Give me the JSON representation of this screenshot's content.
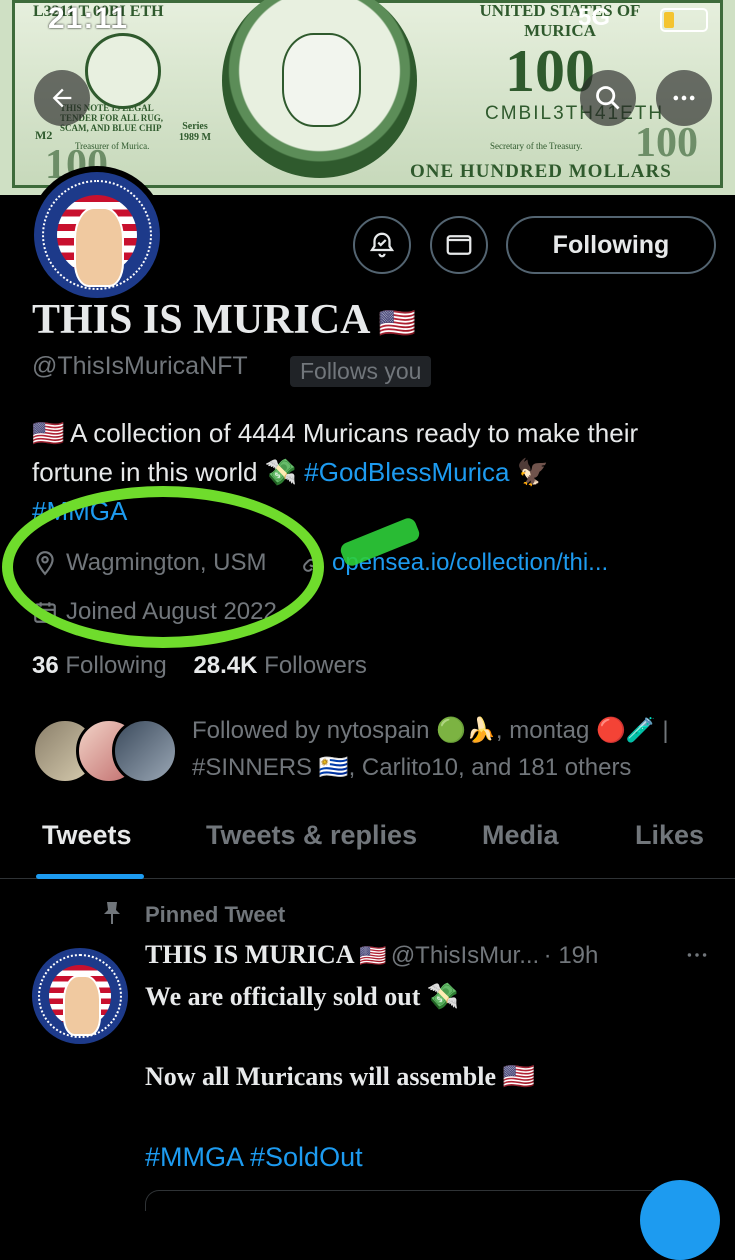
{
  "status_bar": {
    "time": "21:11",
    "network": "5G"
  },
  "banner": {
    "top_left_text": "L3211 T 00BI ETH",
    "top_right_text": "UNITED STATES OF MURICA",
    "big_number": "100",
    "serial": "CMBIL3TH41ETH",
    "bottom_text": "ONE HUNDRED MOLLARS",
    "tender_text": "THIS NOTE IS LEGAL TENDER FOR ALL RUG, SCAM, AND BLUE CHIP",
    "left_signer": "Treasurer of Murica.",
    "right_signer": "Secretary of the Treasury.",
    "series": "Series 1989 M",
    "corner_mark": "M2"
  },
  "profile": {
    "name": "THIS IS MURICA",
    "name_flag": "🇺🇸",
    "handle": "@ThisIsMuricaNFT",
    "follows_you": "Follows you",
    "follow_button": "Following",
    "bio_flag": "🇺🇸",
    "bio_text": "A collection of 4444 Muricans ready to make their fortune in this world 💸",
    "bio_hashtag1": "#GodBlessMurica",
    "bio_emoji": "🦅",
    "bio_hashtag2": "#MMGA",
    "location": "Wagmington, USM",
    "website": "opensea.io/collection/thi...",
    "joined": "Joined August 2022",
    "following_count": "36",
    "following_label": "Following",
    "followers_count": "28.4K",
    "followers_label": "Followers",
    "followed_by_line1": "Followed by nytospain 🟢🍌, montag 🔴🧪 |",
    "followed_by_line2": "#SINNERS 🇺🇾, Carlito10, and 181 others"
  },
  "tabs": [
    {
      "label": "Tweets",
      "active": true
    },
    {
      "label": "Tweets & replies",
      "active": false
    },
    {
      "label": "Media",
      "active": false
    },
    {
      "label": "Likes",
      "active": false
    }
  ],
  "pinned_tweet": {
    "pinned_label": "Pinned Tweet",
    "author": "THIS IS MURICA",
    "author_flag": "🇺🇸",
    "handle": "@ThisIsMur...",
    "time": "· 19h",
    "line1": "We are officially sold out 💸",
    "line2": "Now all Muricans will assemble 🇺🇸",
    "hashtags": "#MMGA #SoldOut"
  },
  "colors": {
    "accent": "#1d9bf0",
    "highlight": "#6fdc2c",
    "muted": "#71767b",
    "bill_green": "#2f5a2d"
  },
  "icons": [
    "back-arrow-icon",
    "search-icon",
    "more-icon",
    "notification-bell-icon",
    "mail-icon",
    "location-pin-icon",
    "link-icon",
    "calendar-icon",
    "pin-icon"
  ]
}
